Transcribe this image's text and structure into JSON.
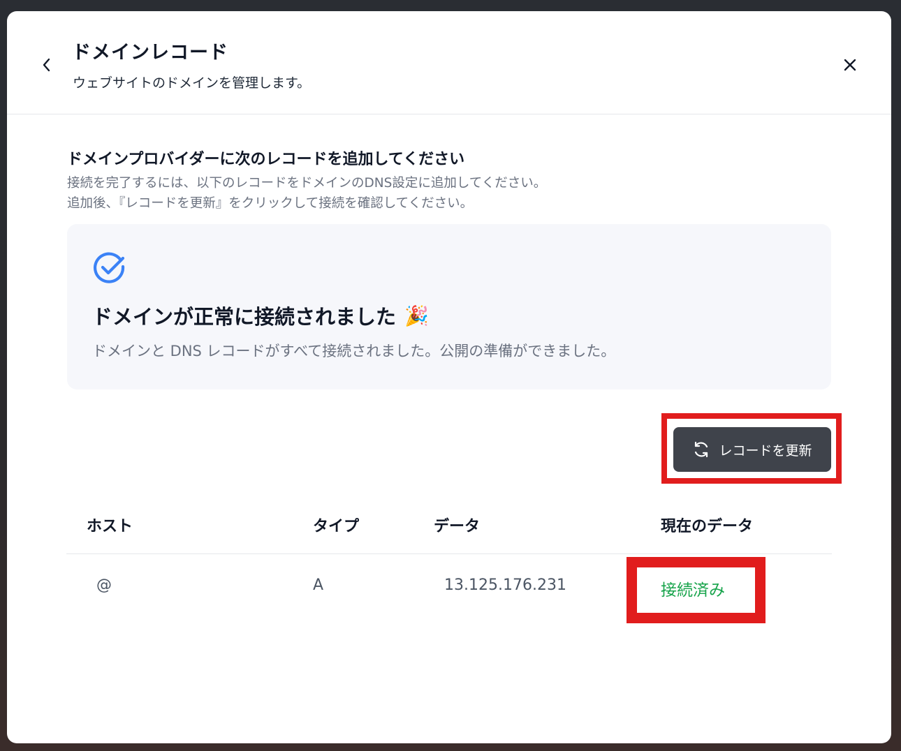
{
  "header": {
    "title": "ドメインレコード",
    "subtitle": "ウェブサイトのドメインを管理します。"
  },
  "instructions": {
    "title": "ドメインプロバイダーに次のレコードを追加してください",
    "line1": "接続を完了するには、以下のレコードをドメインのDNS設定に追加してください。",
    "line2": "追加後、『レコードを更新』をクリックして接続を確認してください。"
  },
  "success": {
    "title": "ドメインが正常に接続されました",
    "emoji": "🎉",
    "description": "ドメインと DNS レコードがすべて接続されました。公開の準備ができました。"
  },
  "refresh_button": {
    "label": "レコードを更新"
  },
  "table": {
    "headers": [
      "ホスト",
      "タイプ",
      "データ",
      "現在のデータ"
    ],
    "rows": [
      {
        "host": "@",
        "type": "A",
        "data": "13.125.176.231",
        "status": "接続済み"
      }
    ]
  },
  "colors": {
    "accent": "#3b82f6",
    "success": "#16a34a",
    "highlight": "#e11d1d",
    "button_bg": "#3f434b"
  }
}
